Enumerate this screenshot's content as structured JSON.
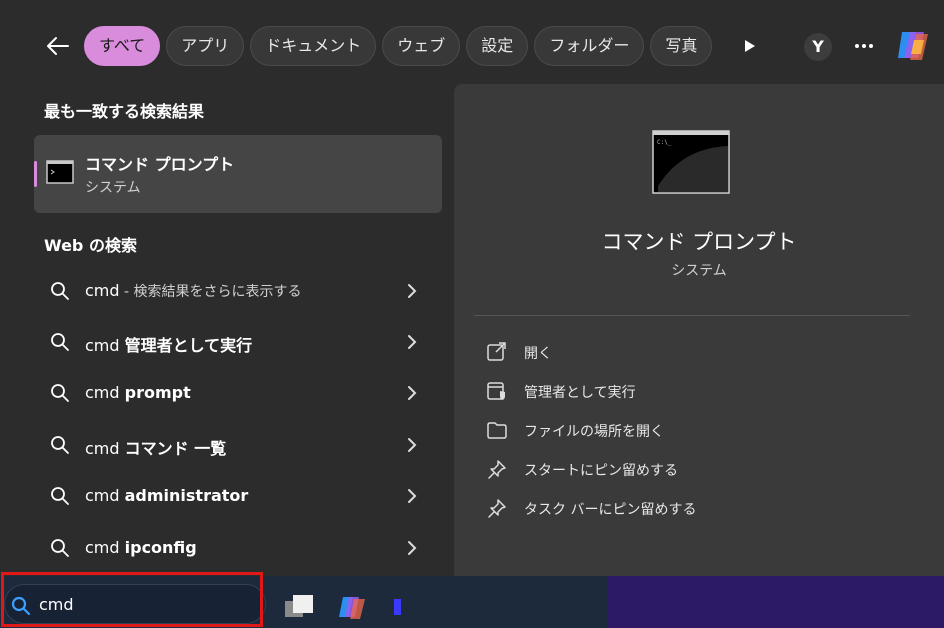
{
  "filters": [
    "すべて",
    "アプリ",
    "ドキュメント",
    "ウェブ",
    "設定",
    "フォルダー",
    "写真"
  ],
  "avatar_initial": "Y",
  "left": {
    "best_match_heading": "最も一致する検索結果",
    "best_match": {
      "title": "コマンド プロンプト",
      "subtitle": "システム"
    },
    "web_heading": "Web の検索",
    "web_results": [
      {
        "query": "cmd",
        "bold": "",
        "desc": " - 検索結果をさらに表示する"
      },
      {
        "query": "cmd ",
        "bold": "管理者として実行",
        "desc": ""
      },
      {
        "query": "cmd ",
        "bold": "prompt",
        "desc": ""
      },
      {
        "query": "cmd ",
        "bold": "コマンド 一覧",
        "desc": ""
      },
      {
        "query": "cmd ",
        "bold": "administrator",
        "desc": ""
      },
      {
        "query": "cmd ",
        "bold": "ipconfig",
        "desc": ""
      }
    ]
  },
  "preview": {
    "title": "コマンド プロンプト",
    "subtitle": "システム",
    "actions": [
      {
        "icon": "open-icon",
        "label": "開く"
      },
      {
        "icon": "admin-shield-icon",
        "label": "管理者として実行"
      },
      {
        "icon": "folder-icon",
        "label": "ファイルの場所を開く"
      },
      {
        "icon": "pin-icon",
        "label": "スタートにピン留めする"
      },
      {
        "icon": "pin-icon",
        "label": "タスク バーにピン留めする"
      }
    ]
  },
  "taskbar": {
    "search_text": "cmd"
  },
  "colors": {
    "accent": "#d98cdc",
    "highlight": "#e01818",
    "panel": "#3a3a3a",
    "background": "#2c2c2c"
  }
}
